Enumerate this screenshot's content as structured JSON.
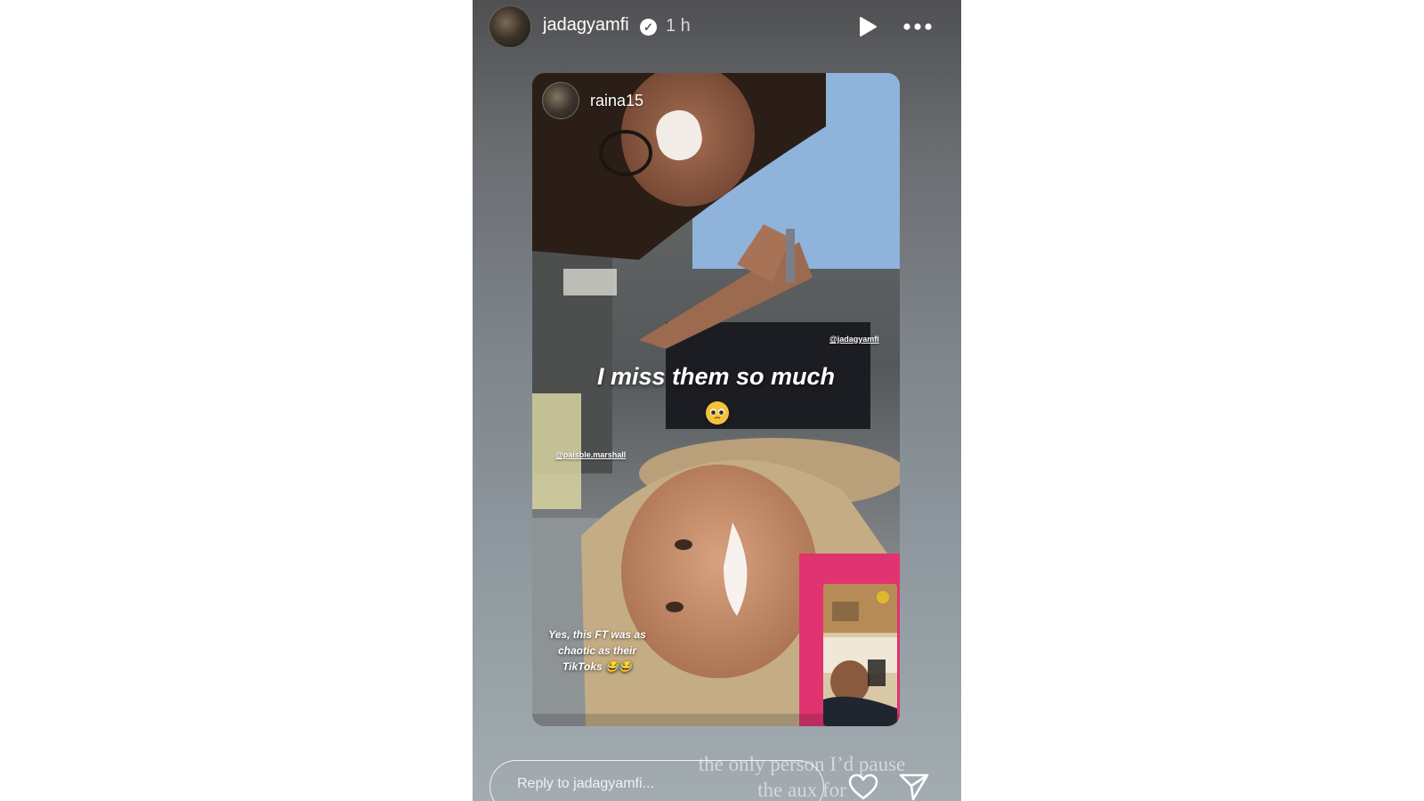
{
  "story": {
    "username": "jadagyamfi",
    "time_ago": "1 h",
    "verified_glyph": "✓",
    "icons": {
      "avatar": "profile-avatar",
      "verified": "verified-badge-icon",
      "play": "play-icon",
      "more": "more-options-icon"
    }
  },
  "shared_post": {
    "username": "raina15",
    "mention_top": "@jadagyamfi",
    "mention_left": "@paisble.marshall",
    "caption": "I miss them so much",
    "emoji": "pleading-face-emoji",
    "sub_caption": "Yes, this FT was as\nchaotic as their\nTikToks 😂😂"
  },
  "reply": {
    "placeholder": "Reply to jadagyamfi...",
    "overlay_text": "the only person I’d pause\nthe aux for",
    "icons": {
      "like": "heart-icon",
      "share": "send-icon"
    }
  },
  "colors": {
    "story_bg_top": "#4f5052",
    "story_bg_bottom": "#a2acb1",
    "text": "#ffffff"
  }
}
